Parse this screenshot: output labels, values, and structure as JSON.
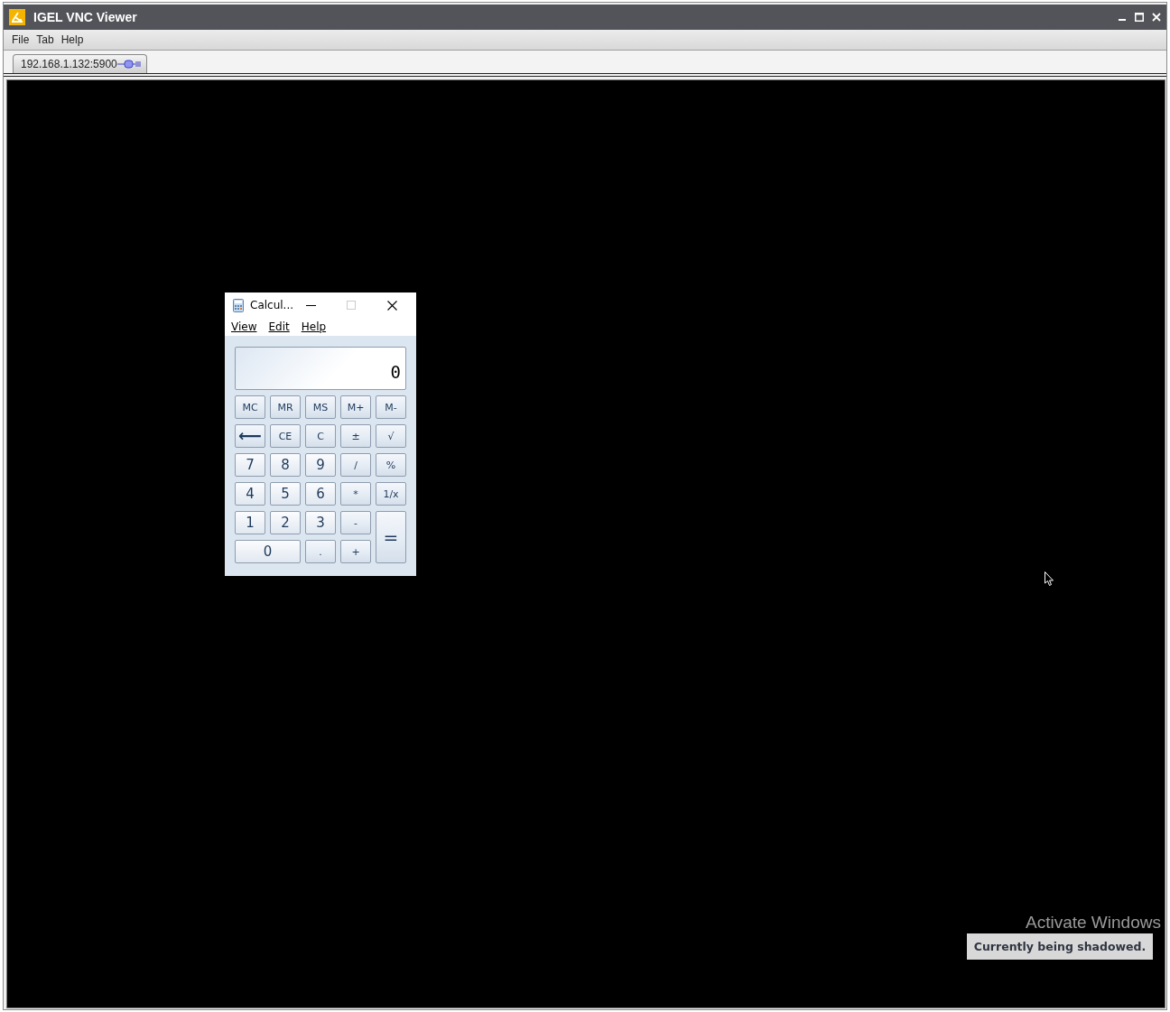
{
  "window": {
    "title": "IGEL VNC Viewer"
  },
  "menu": [
    "File",
    "Tab",
    "Help"
  ],
  "tabs": [
    {
      "label": "192.168.1.132:5900",
      "selected": true
    }
  ],
  "remote": {
    "calculator": {
      "title": "Calcul...",
      "menu": [
        "View",
        "Edit",
        "Help"
      ],
      "display": "0",
      "keys": [
        {
          "label": "MC",
          "kind": "key"
        },
        {
          "label": "MR",
          "kind": "key"
        },
        {
          "label": "MS",
          "kind": "key"
        },
        {
          "label": "M+",
          "kind": "key"
        },
        {
          "label": "M-",
          "kind": "key"
        },
        {
          "label": "⟵",
          "kind": "icon"
        },
        {
          "label": "CE",
          "kind": "key"
        },
        {
          "label": "C",
          "kind": "key"
        },
        {
          "label": "±",
          "kind": "key"
        },
        {
          "label": "√",
          "kind": "key"
        },
        {
          "label": "7",
          "kind": "digit"
        },
        {
          "label": "8",
          "kind": "digit"
        },
        {
          "label": "9",
          "kind": "digit"
        },
        {
          "label": "/",
          "kind": "key"
        },
        {
          "label": "%",
          "kind": "key"
        },
        {
          "label": "4",
          "kind": "digit"
        },
        {
          "label": "5",
          "kind": "digit"
        },
        {
          "label": "6",
          "kind": "digit"
        },
        {
          "label": "*",
          "kind": "key"
        },
        {
          "label": "1/x",
          "kind": "key"
        },
        {
          "label": "1",
          "kind": "digit"
        },
        {
          "label": "2",
          "kind": "digit"
        },
        {
          "label": "3",
          "kind": "digit"
        },
        {
          "label": "-",
          "kind": "key"
        },
        {
          "label": "=",
          "kind": "tall"
        },
        {
          "label": "0",
          "kind": "wide"
        },
        {
          "label": ".",
          "kind": "key"
        },
        {
          "label": "+",
          "kind": "key"
        }
      ]
    },
    "activation_notice": [
      "Activate Windows"
    ],
    "status_label": "Currently being shadowed."
  }
}
